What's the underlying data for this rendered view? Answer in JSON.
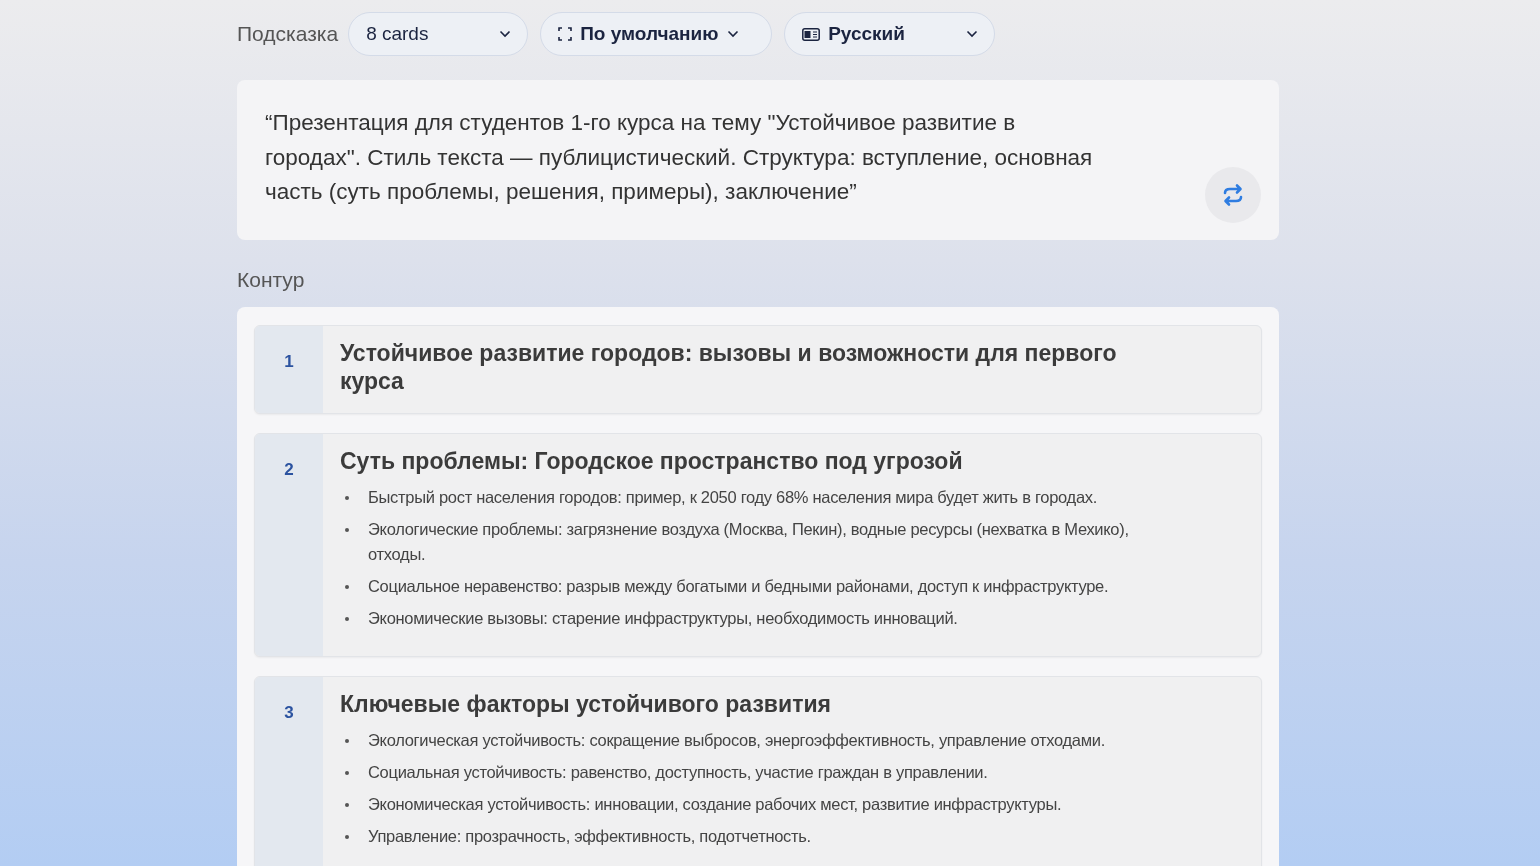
{
  "toolbar": {
    "label": "Подсказка",
    "dropdowns": [
      {
        "kind": "plain",
        "value": "8 cards"
      },
      {
        "kind": "frame",
        "value": "По умолчанию"
      },
      {
        "kind": "language",
        "value": "Русский"
      }
    ]
  },
  "prompt": {
    "text": "“Презентация для студентов 1-го курса на тему \"Устойчивое развитие в городах\". Стиль текста — публицистический. Структура: вступление, основная часть (суть проблемы, решения, примеры), заключение”"
  },
  "outline": {
    "title": "Контур",
    "cards": [
      {
        "number": "1",
        "title": "Устойчивое развитие городов: вызовы и возможности для первого курса"
      },
      {
        "number": "2",
        "title": "Суть проблемы: Городское пространство под угрозой",
        "bullets": [
          "Быстрый рост населения городов: пример, к 2050 году 68% населения мира будет жить в городах.",
          "Экологические проблемы: загрязнение воздуха (Москва, Пекин), водные ресурсы (нехватка в Мехико), отходы.",
          "Социальное неравенство: разрыв между богатыми и бедными районами, доступ к инфраструктуре.",
          "Экономические вызовы: старение инфраструктуры, необходимость инноваций."
        ]
      },
      {
        "number": "3",
        "title": "Ключевые факторы устойчивого развития",
        "bullets": [
          "Экологическая устойчивость: сокращение выбросов, энергоэффективность, управление отходами.",
          "Социальная устойчивость: равенство, доступность, участие граждан в управлении.",
          "Экономическая устойчивость: инновации, создание рабочих мест, развитие инфраструктуры.",
          "Управление: прозрачность, эффективность, подотчетность."
        ]
      }
    ]
  }
}
